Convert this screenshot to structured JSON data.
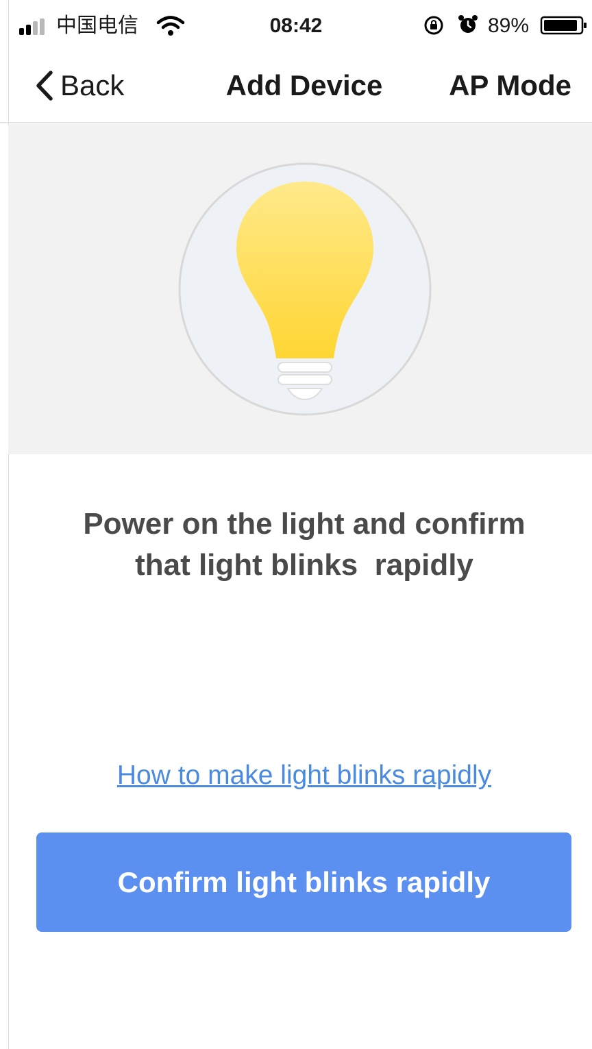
{
  "status_bar": {
    "carrier": "中国电信",
    "time": "08:42",
    "battery_percent": "89%",
    "signal_icon": "cellular-signal-icon",
    "wifi_icon": "wifi-icon",
    "lock_icon": "orientation-lock-icon",
    "alarm_icon": "alarm-clock-icon",
    "battery_icon": "battery-icon",
    "battery_level": 0.89
  },
  "nav": {
    "back_label": "Back",
    "back_icon": "chevron-left-icon",
    "title": "Add Device",
    "right_label": "AP Mode"
  },
  "hero": {
    "illustration_icon": "light-bulb-icon",
    "bulb_color": "#ffd633",
    "background_color": "#f2f2f2"
  },
  "instruction": {
    "line1": "Power on the light and confirm",
    "line2": "that light blinks  rapidly"
  },
  "help_link": "How to make light blinks rapidly",
  "confirm_button_label": "Confirm light blinks rapidly",
  "colors": {
    "accent": "#5b8ff0",
    "link": "#4a8be0",
    "text": "#4a4a4a"
  }
}
